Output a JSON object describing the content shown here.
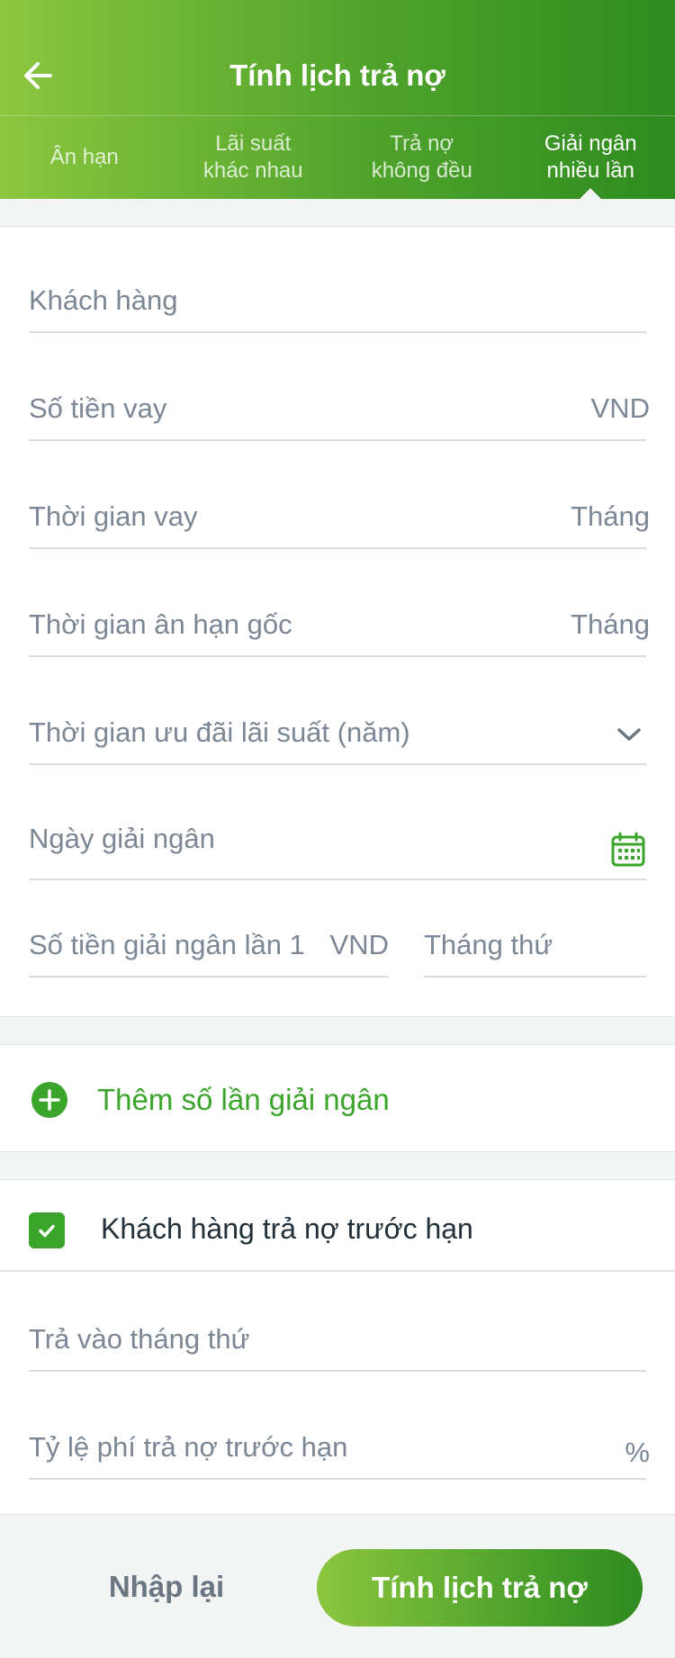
{
  "header": {
    "title": "Tính lịch trả nợ",
    "tabs": [
      {
        "label": "Ân hạn",
        "active": false
      },
      {
        "label": "Lãi suất\nkhác nhau",
        "active": false
      },
      {
        "label": "Trả nợ\nkhông đều",
        "active": false
      },
      {
        "label": "Giải ngân\nnhiều lần",
        "active": true
      }
    ]
  },
  "form": {
    "customer": {
      "placeholder": "Khách hàng"
    },
    "loan_amount": {
      "placeholder": "Số tiền vay",
      "unit": "VND"
    },
    "loan_term": {
      "placeholder": "Thời gian vay",
      "unit": "Tháng"
    },
    "grace_period": {
      "placeholder": "Thời gian ân hạn gốc",
      "unit": "Tháng"
    },
    "promo_period": {
      "placeholder": "Thời gian ưu đãi lãi suất (năm)",
      "icon": "chevron-down-icon"
    },
    "disbursement_date": {
      "placeholder": "Ngày giải ngân",
      "icon": "calendar-icon"
    },
    "disbursement_1": {
      "placeholder": "Số tiền giải ngân lần 1",
      "unit": "VND"
    },
    "month_no": {
      "placeholder": "Tháng thứ"
    }
  },
  "add_disbursement": {
    "label": "Thêm số lần giải ngân",
    "icon": "plus-circle-icon"
  },
  "early_repayment": {
    "checkbox_label": "Khách hàng trả nợ trước hạn",
    "checked": true,
    "pay_month": {
      "placeholder": "Trả vào tháng thứ"
    },
    "fee_rate": {
      "placeholder": "Tỷ lệ phí trả nợ trước hạn",
      "unit": "%"
    }
  },
  "footer": {
    "reset_label": "Nhập lại",
    "submit_label": "Tính lịch trả nợ"
  },
  "colors": {
    "brand_green": "#3aa52a",
    "gradient_start": "#8cc63f",
    "gradient_end": "#2e8b1f"
  }
}
